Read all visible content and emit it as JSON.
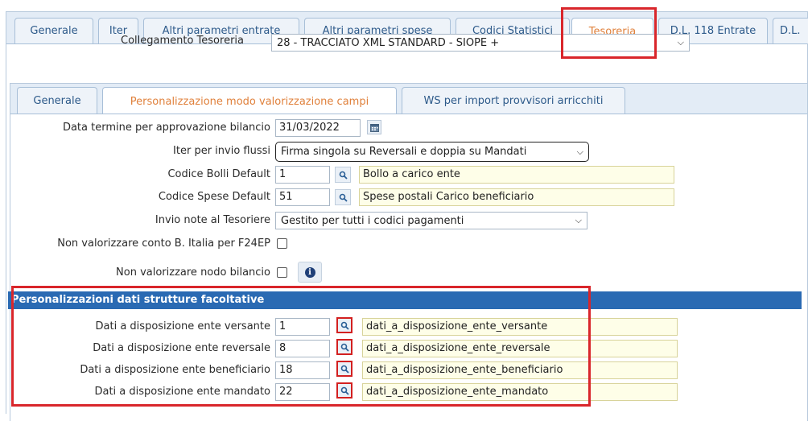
{
  "main_tabs": [
    "Generale",
    "Iter",
    "Altri parametri entrate",
    "Altri parametri spese",
    "Codici Statistici",
    "Tesoreria",
    "D.L. 118 Entrate",
    "D.L."
  ],
  "collegamento": {
    "label": "Collegamento Tesoreria",
    "value": "28 - TRACCIATO XML STANDARD - SIOPE +"
  },
  "sub_tabs": [
    "Generale",
    "Personalizzazione modo valorizzazione campi",
    "WS per import provvisori arricchiti"
  ],
  "form": {
    "data_termine_label": "Data termine per approvazione bilancio",
    "data_termine_value": "31/03/2022",
    "iter_label": "Iter per invio flussi",
    "iter_value": "Firma singola su Reversali e doppia su Mandati",
    "bolli_label": "Codice Bolli Default",
    "bolli_code": "1",
    "bolli_desc": "Bollo a carico  ente",
    "spese_label": "Codice Spese Default",
    "spese_code": "51",
    "spese_desc": "Spese postali Carico beneficiario",
    "note_label": "Invio note al Tesoriere",
    "note_value": "Gestito per tutti i codici pagamenti",
    "conto_label": "Non valorizzare conto B. Italia per F24EP",
    "nodo_label": "Non valorizzare nodo bilancio"
  },
  "section": {
    "title": "Personalizzazioni dati strutture facoltative",
    "rows": [
      {
        "label": "Dati a disposizione ente versante",
        "code": "1",
        "value": "dati_a_disposizione_ente_versante"
      },
      {
        "label": "Dati a disposizione ente reversale",
        "code": "8",
        "value": "dati_a_disposizione_ente_reversale"
      },
      {
        "label": "Dati a disposizione ente beneficiario",
        "code": "18",
        "value": "dati_a_disposizione_ente_beneficiario"
      },
      {
        "label": "Dati a disposizione ente mandato",
        "code": "22",
        "value": "dati_a_disposizione_ente_mandato"
      }
    ]
  },
  "colors": {
    "accent": "#e0813c",
    "tab_text": "#2d5a8a",
    "section_bg": "#2a6ab3",
    "highlight": "#d9262b"
  },
  "icons": [
    "search-icon",
    "calendar-icon",
    "info-icon",
    "chevron-down-icon"
  ]
}
